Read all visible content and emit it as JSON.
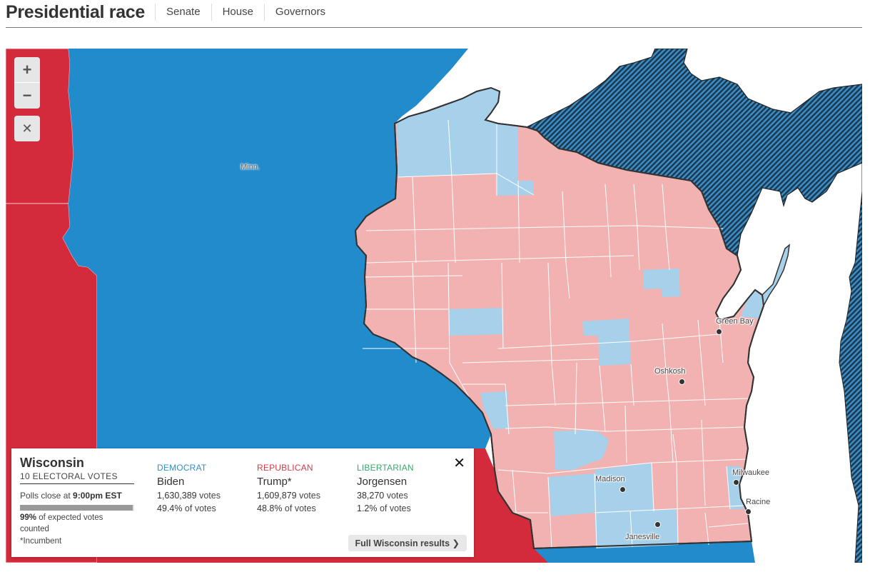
{
  "header": {
    "title": "Presidential race",
    "tabs": [
      {
        "label": "Senate"
      },
      {
        "label": "House"
      },
      {
        "label": "Governors"
      }
    ]
  },
  "map": {
    "zoom_controls": {
      "zoom_in": "+",
      "zoom_out": "−",
      "reset": "✕"
    },
    "colors": {
      "dem_state": "#228bcc",
      "rep_state": "#d42b3c",
      "dem_county": "#a7d1ea",
      "rep_county": "#f3b2b2",
      "uncalled_hatch_dark": "#1a3a55",
      "uncalled_hatch_light": "#3e8fc3",
      "border": "#333333"
    },
    "state_labels": [
      {
        "name": "Minn."
      }
    ],
    "cities": [
      {
        "name": "Green Bay"
      },
      {
        "name": "Oshkosh"
      },
      {
        "name": "Madison"
      },
      {
        "name": "Milwaukee"
      },
      {
        "name": "Racine"
      },
      {
        "name": "Janesville"
      }
    ]
  },
  "infobox": {
    "state": "Wisconsin",
    "electoral_votes": "10 ELECTORAL VOTES",
    "polls_close_prefix": "Polls close at ",
    "polls_close_time": "9:00pm EST",
    "expected_counted_pct": "99%",
    "expected_counted_fraction": 0.99,
    "expected_counted_suffix": " of expected votes counted",
    "incumbent_note": "*Incumbent",
    "close_label": "✕",
    "full_results_label": "Full Wisconsin results ❯",
    "candidates": [
      {
        "party": "DEMOCRAT",
        "party_color": "#2e8fc6",
        "name": "Biden",
        "votes": "1,630,389",
        "votes_suffix": " votes",
        "pct": "49.4%",
        "pct_suffix": " of votes"
      },
      {
        "party": "REPUBLICAN",
        "party_color": "#d43b4a",
        "name": "Trump*",
        "votes": "1,609,879",
        "votes_suffix": " votes",
        "pct": "48.8%",
        "pct_suffix": " of votes"
      },
      {
        "party": "LIBERTARIAN",
        "party_color": "#3aa66b",
        "name": "Jorgensen",
        "votes": "38,270",
        "votes_suffix": " votes",
        "pct": "1.2%",
        "pct_suffix": " of votes"
      }
    ]
  }
}
